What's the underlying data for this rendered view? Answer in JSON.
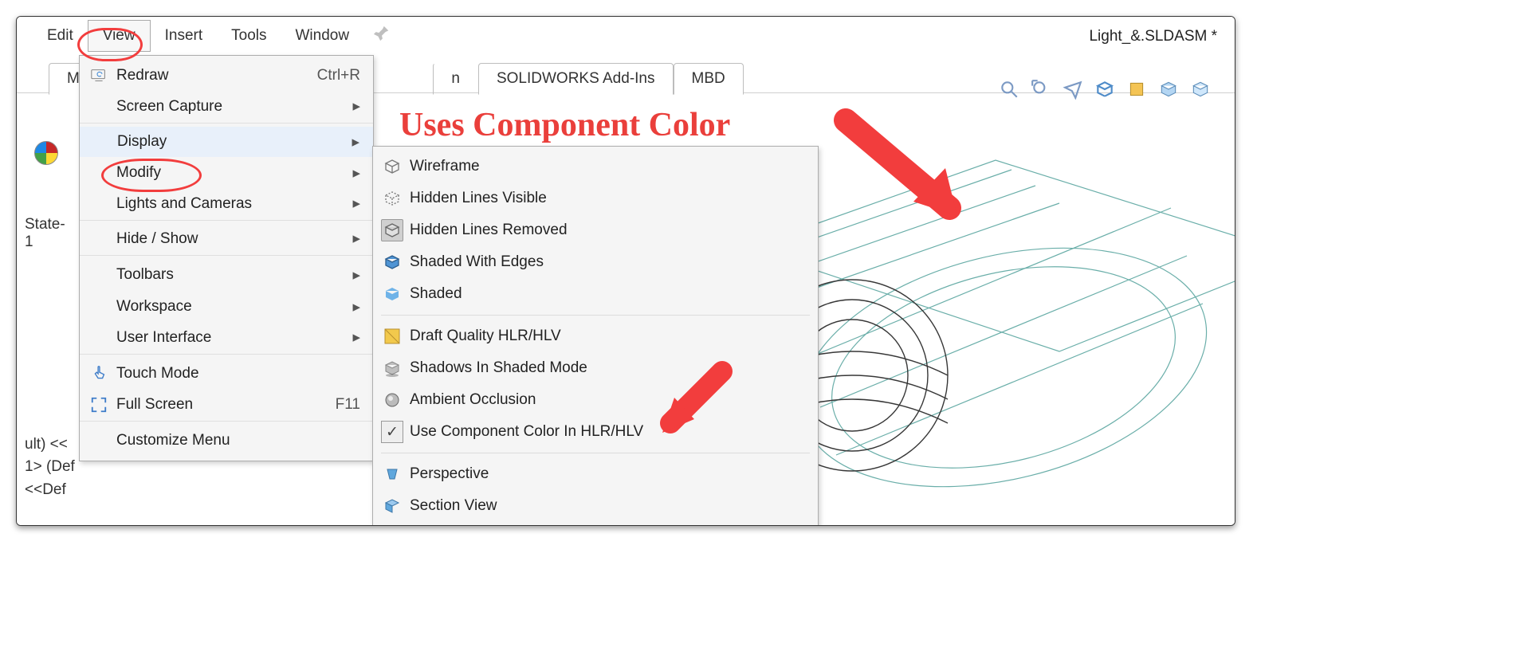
{
  "menubar": {
    "items": [
      "Edit",
      "View",
      "Insert",
      "Tools",
      "Window"
    ],
    "doc_title": "Light_&.SLDASM *"
  },
  "ribbon": {
    "tab_left_partial": "Ma",
    "tab_right_partial": "n",
    "tabs": [
      "SOLIDWORKS Add-Ins",
      "MBD"
    ]
  },
  "view_menu": {
    "items": [
      {
        "label": "Redraw",
        "shortcut": "Ctrl+R",
        "icon": "redraw"
      },
      {
        "label": "Screen Capture",
        "submenu": true
      },
      {
        "label": "Display",
        "submenu": true,
        "circled": true
      },
      {
        "label": "Modify",
        "submenu": true
      },
      {
        "label": "Lights and Cameras",
        "submenu": true
      },
      {
        "label": "Hide / Show",
        "submenu": true
      },
      {
        "label": "Toolbars",
        "submenu": true
      },
      {
        "label": "Workspace",
        "submenu": true
      },
      {
        "label": "User Interface",
        "submenu": true
      },
      {
        "label": "Touch Mode",
        "icon": "touch"
      },
      {
        "label": "Full Screen",
        "shortcut": "F11",
        "icon": "fullscreen"
      },
      {
        "label": "Customize Menu"
      }
    ]
  },
  "display_submenu": {
    "items": [
      {
        "label": "Wireframe",
        "icon": "cube-outline"
      },
      {
        "label": "Hidden Lines Visible",
        "icon": "cube-dashed"
      },
      {
        "label": "Hidden Lines Removed",
        "icon": "cube-solid",
        "highlight": true
      },
      {
        "label": "Shaded With Edges",
        "icon": "cube-shaded-edges"
      },
      {
        "label": "Shaded",
        "icon": "cube-shaded"
      },
      {
        "sep": true
      },
      {
        "label": "Draft Quality HLR/HLV",
        "icon": "dq"
      },
      {
        "label": "Shadows In Shaded Mode",
        "icon": "box"
      },
      {
        "label": "Ambient Occlusion",
        "icon": "sphere"
      },
      {
        "label": "Use Component Color In HLR/HLV",
        "icon": "check",
        "checked": true
      },
      {
        "sep": true
      },
      {
        "label": "Perspective",
        "icon": "persp"
      },
      {
        "label": "Section View",
        "icon": "section"
      }
    ]
  },
  "left": {
    "state_label": "State-1",
    "lines": [
      "ult) <<",
      "1> (Def",
      "<<Def"
    ]
  },
  "annotation_text": "Uses Component Color"
}
